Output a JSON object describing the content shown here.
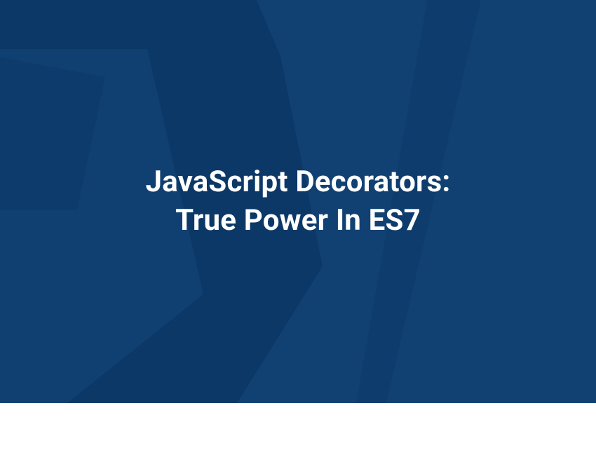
{
  "hero": {
    "title_line1": "JavaScript Decorators:",
    "title_line2": "True Power In ES7"
  },
  "colors": {
    "background": "#0b3866",
    "overlay": "#16477a",
    "text": "#ffffff"
  }
}
